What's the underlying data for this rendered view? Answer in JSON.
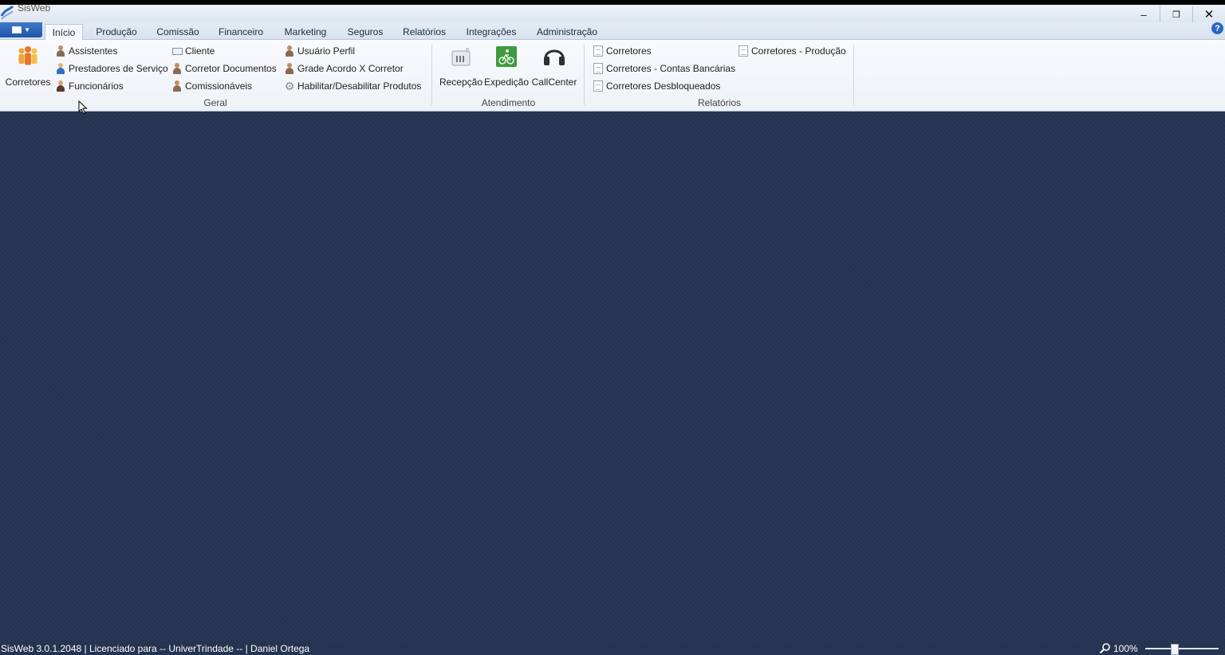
{
  "window": {
    "title": "SisWeb",
    "minimize_icon": "minimize-icon",
    "restore_icon": "restore-icon",
    "close_icon": "close-icon"
  },
  "tabs": [
    {
      "label": "Início",
      "active": true
    },
    {
      "label": "Produção"
    },
    {
      "label": "Comissão"
    },
    {
      "label": "Financeiro"
    },
    {
      "label": "Marketing"
    },
    {
      "label": "Seguros"
    },
    {
      "label": "Relatórios"
    },
    {
      "label": "Integrações"
    },
    {
      "label": "Administração"
    }
  ],
  "ribbon": {
    "geral": {
      "label": "Geral",
      "large": {
        "label": "Corretores",
        "icon": "people-group-icon"
      },
      "col1": [
        {
          "label": "Assistentes",
          "icon": "person-icon"
        },
        {
          "label": "Prestadores de Serviço",
          "icon": "person-blue-icon"
        },
        {
          "label": "Funcionários",
          "icon": "person-dark-icon"
        }
      ],
      "col2": [
        {
          "label": "Cliente",
          "icon": "client-card-icon"
        },
        {
          "label": "Corretor Documentos",
          "icon": "person-icon"
        },
        {
          "label": "Comissionáveis",
          "icon": "person-icon"
        }
      ],
      "col3": [
        {
          "label": "Usuário Perfil",
          "icon": "person-icon"
        },
        {
          "label": "Grade Acordo X Corretor",
          "icon": "person-icon"
        },
        {
          "label": "Habilitar/Desabilitar Produtos",
          "icon": "gear-icon"
        }
      ]
    },
    "atendimento": {
      "label": "Atendimento",
      "items": [
        {
          "label": "Recepção",
          "icon": "reception-counter-icon"
        },
        {
          "label": "Expedição",
          "icon": "delivery-bike-icon"
        },
        {
          "label": "CallCenter",
          "icon": "headset-icon"
        }
      ]
    },
    "relatorios": {
      "label": "Relatórios",
      "col1": [
        {
          "label": "Corretores",
          "icon": "report-icon"
        },
        {
          "label": "Corretores - Contas Bancárias",
          "icon": "report-icon"
        },
        {
          "label": "Corretores Desbloqueados",
          "icon": "report-icon"
        }
      ],
      "col2": [
        {
          "label": "Corretores - Produção",
          "icon": "report-icon"
        }
      ]
    }
  },
  "statusbar": {
    "text": "SisWeb 3.0.1.2048 | Licenciado para -- UniverTrindade -- | Daniel Ortega",
    "zoom_level": "100%",
    "zoom_fraction": 0.4
  },
  "colors": {
    "desktop_bg": "#263452",
    "ribbon_bg": "#f3f6fa",
    "accent": "#2a67c5"
  }
}
